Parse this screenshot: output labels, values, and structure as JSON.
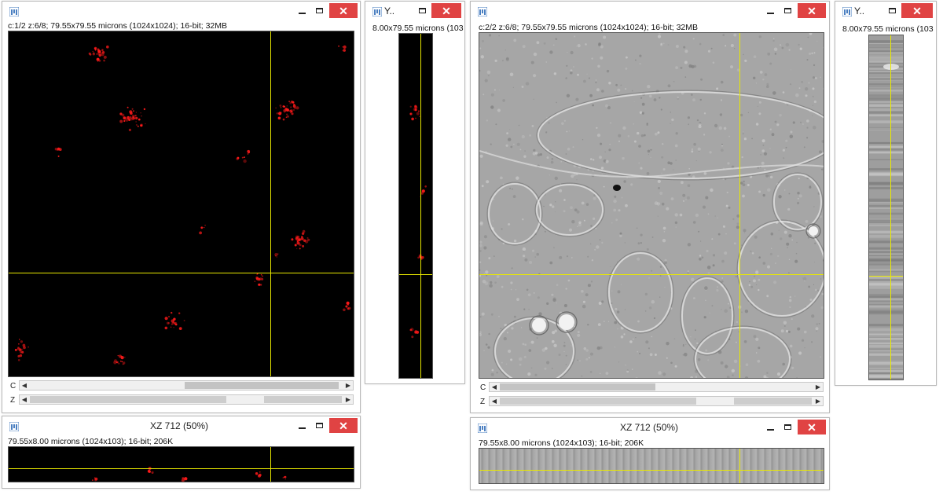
{
  "windows": {
    "ch1_xy": {
      "info": "c:1/2 z:6/8; 79.55x79.55 microns (1024x1024); 16-bit; 32MB",
      "c_label": "C",
      "z_label": "Z"
    },
    "ch1_yz": {
      "title": "Y..",
      "info": "8.00x79.55 microns (103"
    },
    "ch1_xz": {
      "title": "XZ 712 (50%)",
      "info": "79.55x8.00 microns (1024x103); 16-bit; 206K"
    },
    "ch2_xy": {
      "info": "c:2/2 z:6/8; 79.55x79.55 microns (1024x1024); 16-bit; 32MB",
      "c_label": "C",
      "z_label": "Z"
    },
    "ch2_yz": {
      "title": "Y..",
      "info": "8.00x79.55 microns (103"
    },
    "ch2_xz": {
      "title": "XZ 712 (50%)",
      "info": "79.55x8.00 microns (1024x103); 16-bit; 206K"
    }
  },
  "icons": {
    "app": "imagej-window-icon",
    "minimize": "minimize-icon",
    "maximize": "maximize-icon",
    "close": "close-icon",
    "scroll_left": "arrow-left-icon",
    "scroll_right": "arrow-right-icon"
  },
  "colors": {
    "crosshair": "#e8e800",
    "close_button": "#e04343",
    "fluorescence": "#ff1a1a"
  }
}
